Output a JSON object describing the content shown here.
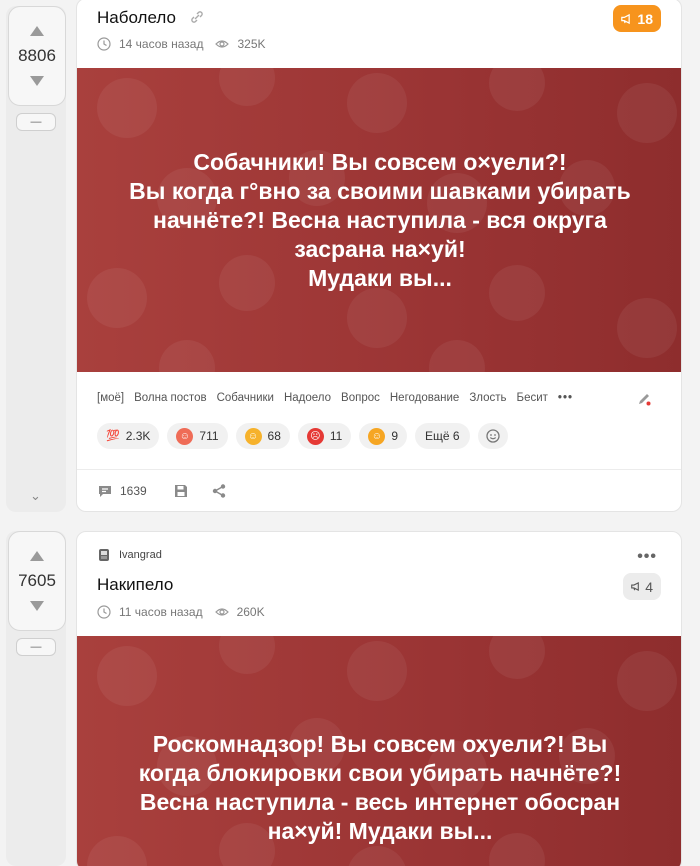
{
  "posts": [
    {
      "rating": "8806",
      "minus": "—",
      "collapse": "⌄",
      "title": "Наболело",
      "time": "14 часов назад",
      "views": "325K",
      "comments_badge": "18",
      "banner_text": "Собачники! Вы совсем о×уели?!\nВы когда г°вно за своими шавками убирать\nначнёте?! Весна наступила - вся округа\nзасрана на×уй!\nМудаки вы...",
      "tags": [
        "[моё]",
        "Волна постов",
        "Собачники",
        "Надоело",
        "Вопрос",
        "Негодование",
        "Злость",
        "Бесит"
      ],
      "tags_more": "•••",
      "reactions": [
        {
          "icon": "hundred-icon",
          "count": "2.3K",
          "color": "#e53935"
        },
        {
          "icon": "clown-icon",
          "count": "711",
          "color": "#ef6c57"
        },
        {
          "icon": "laugh-icon",
          "count": "68",
          "color": "#f6b22c"
        },
        {
          "icon": "angry-icon",
          "count": "11",
          "color": "#e53935"
        },
        {
          "icon": "yawn-icon",
          "count": "9",
          "color": "#f6a623"
        }
      ],
      "reactions_more": "Ещё 6",
      "comments_count": "1639"
    },
    {
      "rating": "7605",
      "minus": "—",
      "author": "Ivangrad",
      "more": "•••",
      "title": "Накипело",
      "time": "11 часов назад",
      "views": "260K",
      "comments_badge": "4",
      "banner_text": "Роскомнадзор! Вы совсем охуели?! Вы\nкогда блокировки свои убирать начнёте?!\nВесна наступила - весь интернет обосран\nна×уй! Мудаки вы..."
    }
  ],
  "colors": {
    "accent_orange": "#f7941d",
    "banner_red": "#9a3434"
  }
}
